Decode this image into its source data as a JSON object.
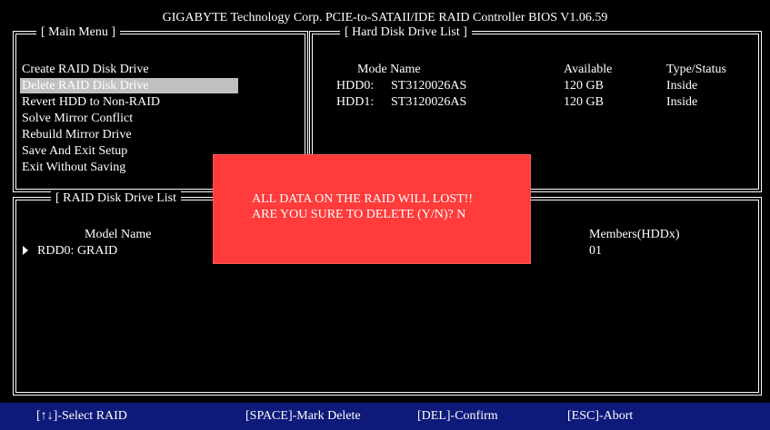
{
  "title": "GIGABYTE Technology Corp. PCIE-to-SATAII/IDE RAID Controller BIOS V1.06.59",
  "main_menu": {
    "title": "[ Main Menu ]",
    "items": [
      {
        "label": "Create RAID Disk Drive"
      },
      {
        "label": "Delete RAID Disk Drive",
        "selected": true
      },
      {
        "label": "Revert HDD to Non-RAID"
      },
      {
        "label": "Solve Mirror Conflict"
      },
      {
        "label": "Rebuild Mirror Drive"
      },
      {
        "label": "Save And Exit Setup"
      },
      {
        "label": "Exit Without Saving"
      }
    ]
  },
  "hdd_list": {
    "title": "[ Hard Disk Drive List ]",
    "headers": {
      "mode_name": "Mode Name",
      "available": "Available",
      "type_status": "Type/Status"
    },
    "rows": [
      {
        "id": "HDD0:",
        "model": "ST3120026AS",
        "available": "120 GB",
        "status": "Inside"
      },
      {
        "id": "HDD1:",
        "model": "ST3120026AS",
        "available": "120 GB",
        "status": "Inside"
      }
    ]
  },
  "raid_list": {
    "title": "[ RAID Disk Drive List",
    "headers": {
      "model_name": "Model Name",
      "members": "Members(HDDx)"
    },
    "rows": [
      {
        "name": "RDD0: GRAID",
        "members": "01"
      }
    ]
  },
  "dialog": {
    "line1": "ALL DATA ON THE RAID WILL LOST!!",
    "line2": "ARE YOU SURE TO DELETE (Y/N)? N"
  },
  "footer": {
    "select": "[↑↓]-Select RAID",
    "mark": "[SPACE]-Mark Delete",
    "confirm": "[DEL]-Confirm",
    "abort": "[ESC]-Abort"
  },
  "colors": {
    "background": "#000000",
    "dialog": "#ff3b3b",
    "footer": "#0e1a7a",
    "selection": "#c0c0c0"
  }
}
